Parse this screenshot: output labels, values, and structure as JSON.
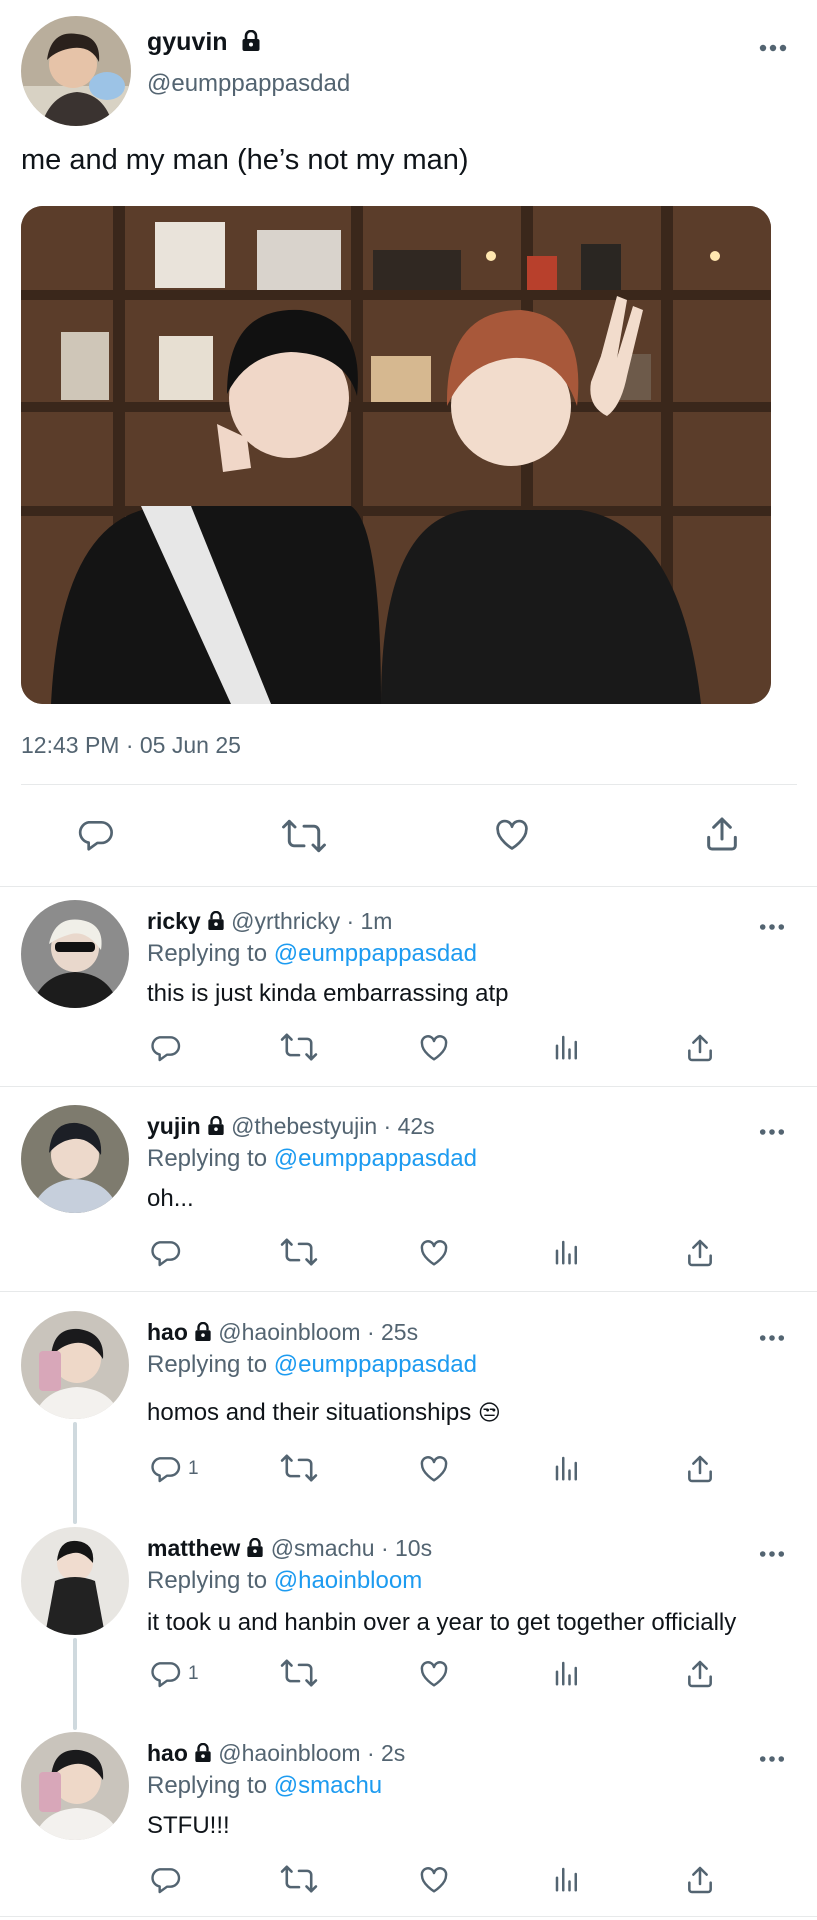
{
  "main_tweet": {
    "display_name": "gyuvin",
    "handle": "@eumppappasdad",
    "text": "me and my man (he’s not my man)",
    "timestamp": "12:43 PM · 05 Jun 25"
  },
  "replies": [
    {
      "display_name": "ricky",
      "handle_time": "@yrthricky · 1m",
      "replying_label": "Replying to",
      "replying_to": "@eumppappasdad",
      "text": "this is just kinda embarrassing atp",
      "reply_count": ""
    },
    {
      "display_name": "yujin",
      "handle_time": "@thebestyujin · 42s",
      "replying_label": "Replying to",
      "replying_to": "@eumppappasdad",
      "text": "oh...",
      "reply_count": ""
    },
    {
      "display_name": "hao",
      "handle_time": "@haoinbloom · 25s",
      "replying_label": "Replying to",
      "replying_to": "@eumppappasdad",
      "text": "homos and their situationships",
      "emoji": "😒",
      "reply_count": "1"
    },
    {
      "display_name": "matthew",
      "handle_time": "@smachu · 10s",
      "replying_label": "Replying to",
      "replying_to": "@haoinbloom",
      "text": "it took u and hanbin over a year to get together officially",
      "reply_count": "1"
    },
    {
      "display_name": "hao",
      "handle_time": "@haoinbloom · 2s",
      "replying_label": "Replying to",
      "replying_to": "@smachu",
      "text": "STFU!!!",
      "reply_count": ""
    }
  ],
  "icons": {
    "lock": "lock-icon",
    "more": "more-icon",
    "reply": "reply-icon",
    "retweet": "retweet-icon",
    "like": "heart-icon",
    "views": "views-icon",
    "share": "share-icon"
  },
  "colors": {
    "link": "#1d9bf0",
    "secondary_text": "#536471",
    "divider": "#e7e9ea"
  }
}
